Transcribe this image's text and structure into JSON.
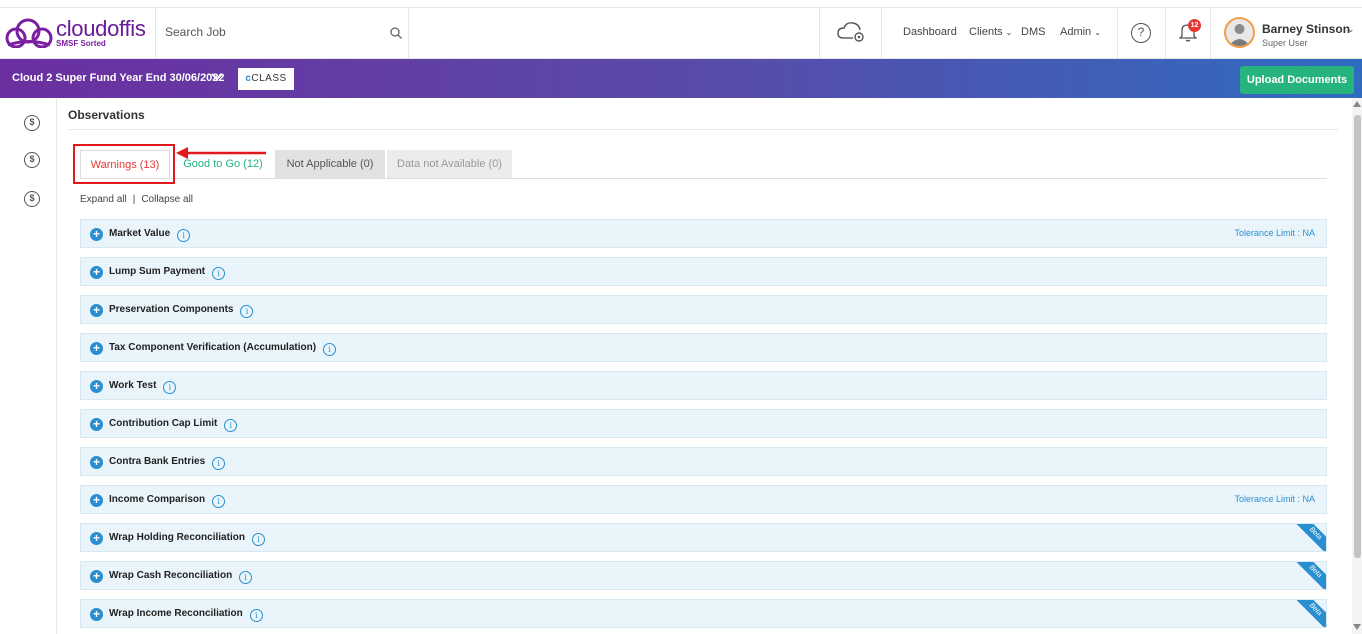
{
  "header": {
    "logo_name": "cloudoffis",
    "logo_tagline": "SMSF Sorted",
    "search_placeholder": "Search Job",
    "nav": [
      {
        "label": "Dashboard",
        "has_caret": false
      },
      {
        "label": "Clients",
        "has_caret": true
      },
      {
        "label": "DMS",
        "has_caret": false
      },
      {
        "label": "Admin",
        "has_caret": true
      }
    ],
    "help_glyph": "?",
    "notification_count": "12",
    "user_name": "Barney Stinson",
    "user_role": "Super User"
  },
  "banner": {
    "fund_title": "Cloud 2 Super Fund Year End 30/06/2022",
    "class_logo": "CLASS",
    "upload_label": "Upload Documents"
  },
  "side_icons": [
    "dollar-chart-icon",
    "dollar-gear-icon",
    "dollar-chart-icon"
  ],
  "observations": {
    "title": "Observations",
    "tabs": [
      {
        "label": "Warnings (13)",
        "state": "active"
      },
      {
        "label": "Good to Go (12)",
        "state": "normal"
      },
      {
        "label": "Not Applicable (0)",
        "state": "normal"
      },
      {
        "label": "Data not Available (0)",
        "state": "disabled"
      }
    ],
    "expand_all": "Expand all",
    "separator": "|",
    "collapse_all": "Collapse all",
    "items": [
      {
        "label": "Market Value",
        "tolerance": "Tolerance Limit : NA",
        "beta": ""
      },
      {
        "label": "Lump Sum Payment",
        "tolerance": "",
        "beta": ""
      },
      {
        "label": "Preservation Components",
        "tolerance": "",
        "beta": ""
      },
      {
        "label": "Tax Component Verification (Accumulation)",
        "tolerance": "",
        "beta": ""
      },
      {
        "label": "Work Test",
        "tolerance": "",
        "beta": ""
      },
      {
        "label": "Contribution Cap Limit",
        "tolerance": "",
        "beta": ""
      },
      {
        "label": "Contra Bank Entries",
        "tolerance": "",
        "beta": ""
      },
      {
        "label": "Income Comparison",
        "tolerance": "Tolerance Limit : NA",
        "beta": ""
      },
      {
        "label": "Wrap Holding Reconciliation",
        "tolerance": "",
        "beta": "Beta"
      },
      {
        "label": "Wrap Cash Reconciliation",
        "tolerance": "",
        "beta": "Beta"
      },
      {
        "label": "Wrap Income Reconciliation",
        "tolerance": "",
        "beta": "Beta"
      }
    ]
  },
  "colors": {
    "brand_purple": "#6a1b9a",
    "upload_green": "#26b37e",
    "warning_red": "#e53935",
    "info_blue": "#2a8fd0",
    "accordion_bg": "#eaf5fb"
  }
}
